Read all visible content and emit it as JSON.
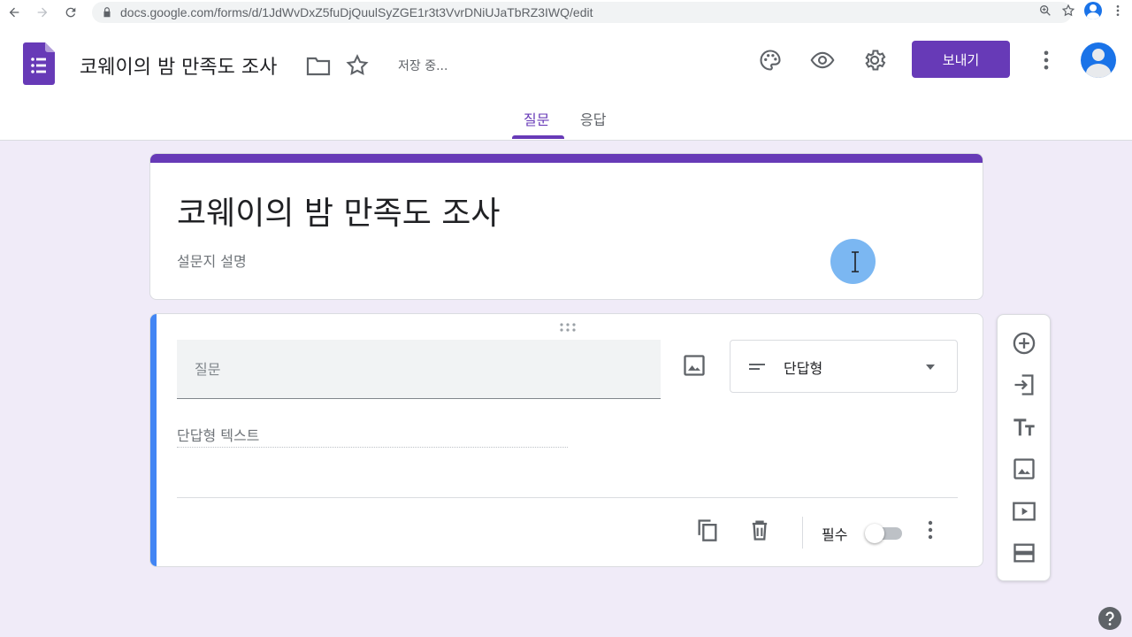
{
  "browser": {
    "url": "docs.google.com/forms/d/1JdWvDxZ5fuDjQuulSyZGE1r3t3VvrDNiUJaTbRZ3IWQ/edit"
  },
  "header": {
    "doc_title": "코웨이의 밤 만족도 조사",
    "save_status": "저장 중...",
    "send_label": "보내기",
    "tabs": [
      {
        "label": "질문",
        "active": true
      },
      {
        "label": "응답",
        "active": false
      }
    ]
  },
  "form": {
    "title": "코웨이의 밤 만족도 조사",
    "description_placeholder": "설문지 설명"
  },
  "question": {
    "title_placeholder": "질문",
    "type_label": "단답형",
    "answer_placeholder": "단답형 텍스트",
    "required_label": "필수",
    "required": false
  },
  "colors": {
    "brand": "#673ab7",
    "accent_blue": "#4285f4",
    "background": "#f0ebf8"
  },
  "icons": {
    "toolbar": [
      "add-question-icon",
      "import-questions-icon",
      "add-title-icon",
      "add-image-icon",
      "add-video-icon",
      "add-section-icon"
    ]
  }
}
